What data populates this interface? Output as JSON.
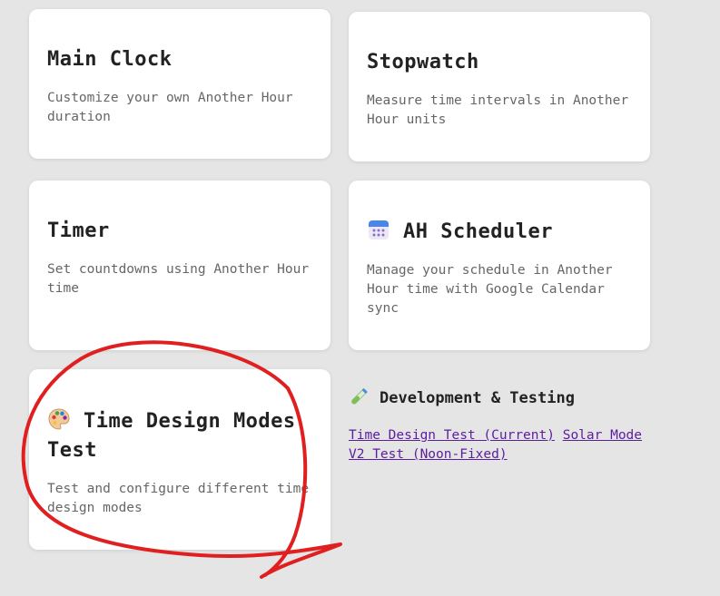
{
  "cards": [
    {
      "title": "Main Clock",
      "description": "Customize your own Another Hour duration"
    },
    {
      "title": "Stopwatch",
      "description": "Measure time intervals in Another Hour units"
    },
    {
      "title": "Timer",
      "description": "Set countdowns using Another Hour time"
    },
    {
      "title": "AH Scheduler",
      "description": "Manage your schedule in Another Hour time with Google Calendar sync",
      "icon": "calendar-icon"
    },
    {
      "title": "Time Design Modes Test",
      "description": "Test and configure different time design modes",
      "icon": "palette-icon"
    }
  ],
  "dev": {
    "title": "Development & Testing",
    "icon": "test-tube-icon",
    "links": [
      "Time Design Test (Current)",
      "Solar Mode V2 Test (Noon-Fixed)"
    ]
  },
  "colors": {
    "background": "#e5e5e5",
    "card": "#ffffff",
    "link": "#5a1e9e",
    "annotation": "#e02020"
  }
}
